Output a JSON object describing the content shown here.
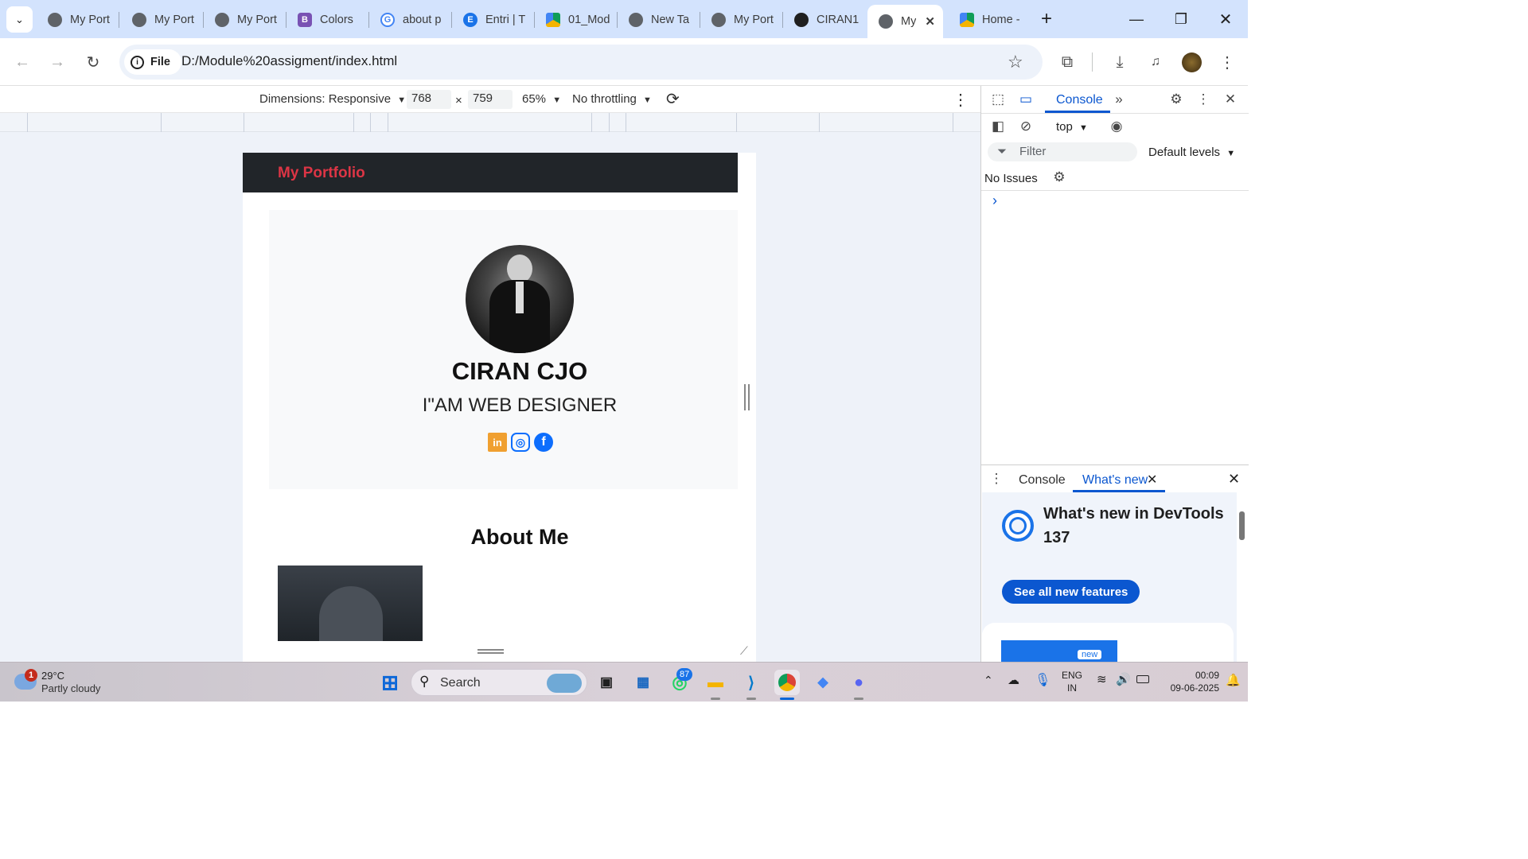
{
  "tabs": [
    {
      "title": "My Port",
      "favicon": "globe-icon"
    },
    {
      "title": "My Port",
      "favicon": "globe-icon"
    },
    {
      "title": "My Port",
      "favicon": "globe-icon"
    },
    {
      "title": "Colors",
      "favicon": "bootstrap-icon"
    },
    {
      "title": "about p",
      "favicon": "google-icon"
    },
    {
      "title": "Entri | T",
      "favicon": "entri-icon"
    },
    {
      "title": "01_Mod",
      "favicon": "drive-icon"
    },
    {
      "title": "New Ta",
      "favicon": "chrome-icon"
    },
    {
      "title": "My Port",
      "favicon": "globe-icon"
    },
    {
      "title": "CIRAN1",
      "favicon": "github-icon"
    },
    {
      "title": "My",
      "favicon": "globe-icon",
      "active": true
    },
    {
      "title": "Home -",
      "favicon": "drive-icon"
    }
  ],
  "omnibox": {
    "chip": "File",
    "url": "D:/Module%20assigment/index.html"
  },
  "device_toolbar": {
    "dimensions_label": "Dimensions: Responsive",
    "width": "768",
    "times": "×",
    "height": "759",
    "zoom": "65%",
    "throttling": "No throttling"
  },
  "site": {
    "brand": "My Portfolio",
    "name": "CIRAN CJO",
    "role": "I\"AM WEB DESIGNER",
    "about_title": "About Me",
    "social": [
      "linkedin-icon",
      "instagram-icon",
      "facebook-icon"
    ]
  },
  "devtools": {
    "main_tab": "Console",
    "context": "top",
    "filter_placeholder": "Filter",
    "levels": "Default levels",
    "issues": "No Issues",
    "prompt": "›",
    "drawer_tabs": [
      "Console",
      "What's new"
    ],
    "whats_new_title": "What's new in DevTools 137",
    "whats_new_button": "See all new features",
    "badge": "new"
  },
  "taskbar": {
    "weather_temp": "29°C",
    "weather_desc": "Partly cloudy",
    "weather_badge": "1",
    "search": "Search",
    "whatsapp_badge": "87",
    "lang_top": "ENG",
    "lang_bottom": "IN",
    "time": "00:09",
    "date": "09-06-2025"
  },
  "colors": {
    "brand_red": "#dc3545",
    "nav_dark": "#212529",
    "chrome_blue": "#0b57d0"
  }
}
